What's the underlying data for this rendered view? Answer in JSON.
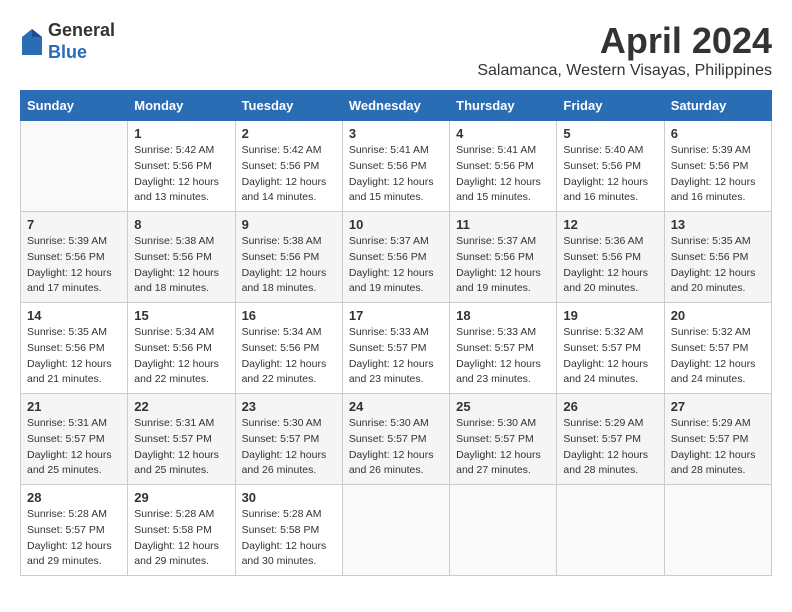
{
  "logo": {
    "general": "General",
    "blue": "Blue"
  },
  "title": "April 2024",
  "location": "Salamanca, Western Visayas, Philippines",
  "days_header": [
    "Sunday",
    "Monday",
    "Tuesday",
    "Wednesday",
    "Thursday",
    "Friday",
    "Saturday"
  ],
  "weeks": [
    [
      {
        "day": "",
        "info": ""
      },
      {
        "day": "1",
        "info": "Sunrise: 5:42 AM\nSunset: 5:56 PM\nDaylight: 12 hours\nand 13 minutes."
      },
      {
        "day": "2",
        "info": "Sunrise: 5:42 AM\nSunset: 5:56 PM\nDaylight: 12 hours\nand 14 minutes."
      },
      {
        "day": "3",
        "info": "Sunrise: 5:41 AM\nSunset: 5:56 PM\nDaylight: 12 hours\nand 15 minutes."
      },
      {
        "day": "4",
        "info": "Sunrise: 5:41 AM\nSunset: 5:56 PM\nDaylight: 12 hours\nand 15 minutes."
      },
      {
        "day": "5",
        "info": "Sunrise: 5:40 AM\nSunset: 5:56 PM\nDaylight: 12 hours\nand 16 minutes."
      },
      {
        "day": "6",
        "info": "Sunrise: 5:39 AM\nSunset: 5:56 PM\nDaylight: 12 hours\nand 16 minutes."
      }
    ],
    [
      {
        "day": "7",
        "info": "Sunrise: 5:39 AM\nSunset: 5:56 PM\nDaylight: 12 hours\nand 17 minutes."
      },
      {
        "day": "8",
        "info": "Sunrise: 5:38 AM\nSunset: 5:56 PM\nDaylight: 12 hours\nand 18 minutes."
      },
      {
        "day": "9",
        "info": "Sunrise: 5:38 AM\nSunset: 5:56 PM\nDaylight: 12 hours\nand 18 minutes."
      },
      {
        "day": "10",
        "info": "Sunrise: 5:37 AM\nSunset: 5:56 PM\nDaylight: 12 hours\nand 19 minutes."
      },
      {
        "day": "11",
        "info": "Sunrise: 5:37 AM\nSunset: 5:56 PM\nDaylight: 12 hours\nand 19 minutes."
      },
      {
        "day": "12",
        "info": "Sunrise: 5:36 AM\nSunset: 5:56 PM\nDaylight: 12 hours\nand 20 minutes."
      },
      {
        "day": "13",
        "info": "Sunrise: 5:35 AM\nSunset: 5:56 PM\nDaylight: 12 hours\nand 20 minutes."
      }
    ],
    [
      {
        "day": "14",
        "info": "Sunrise: 5:35 AM\nSunset: 5:56 PM\nDaylight: 12 hours\nand 21 minutes."
      },
      {
        "day": "15",
        "info": "Sunrise: 5:34 AM\nSunset: 5:56 PM\nDaylight: 12 hours\nand 22 minutes."
      },
      {
        "day": "16",
        "info": "Sunrise: 5:34 AM\nSunset: 5:56 PM\nDaylight: 12 hours\nand 22 minutes."
      },
      {
        "day": "17",
        "info": "Sunrise: 5:33 AM\nSunset: 5:57 PM\nDaylight: 12 hours\nand 23 minutes."
      },
      {
        "day": "18",
        "info": "Sunrise: 5:33 AM\nSunset: 5:57 PM\nDaylight: 12 hours\nand 23 minutes."
      },
      {
        "day": "19",
        "info": "Sunrise: 5:32 AM\nSunset: 5:57 PM\nDaylight: 12 hours\nand 24 minutes."
      },
      {
        "day": "20",
        "info": "Sunrise: 5:32 AM\nSunset: 5:57 PM\nDaylight: 12 hours\nand 24 minutes."
      }
    ],
    [
      {
        "day": "21",
        "info": "Sunrise: 5:31 AM\nSunset: 5:57 PM\nDaylight: 12 hours\nand 25 minutes."
      },
      {
        "day": "22",
        "info": "Sunrise: 5:31 AM\nSunset: 5:57 PM\nDaylight: 12 hours\nand 25 minutes."
      },
      {
        "day": "23",
        "info": "Sunrise: 5:30 AM\nSunset: 5:57 PM\nDaylight: 12 hours\nand 26 minutes."
      },
      {
        "day": "24",
        "info": "Sunrise: 5:30 AM\nSunset: 5:57 PM\nDaylight: 12 hours\nand 26 minutes."
      },
      {
        "day": "25",
        "info": "Sunrise: 5:30 AM\nSunset: 5:57 PM\nDaylight: 12 hours\nand 27 minutes."
      },
      {
        "day": "26",
        "info": "Sunrise: 5:29 AM\nSunset: 5:57 PM\nDaylight: 12 hours\nand 28 minutes."
      },
      {
        "day": "27",
        "info": "Sunrise: 5:29 AM\nSunset: 5:57 PM\nDaylight: 12 hours\nand 28 minutes."
      }
    ],
    [
      {
        "day": "28",
        "info": "Sunrise: 5:28 AM\nSunset: 5:57 PM\nDaylight: 12 hours\nand 29 minutes."
      },
      {
        "day": "29",
        "info": "Sunrise: 5:28 AM\nSunset: 5:58 PM\nDaylight: 12 hours\nand 29 minutes."
      },
      {
        "day": "30",
        "info": "Sunrise: 5:28 AM\nSunset: 5:58 PM\nDaylight: 12 hours\nand 30 minutes."
      },
      {
        "day": "",
        "info": ""
      },
      {
        "day": "",
        "info": ""
      },
      {
        "day": "",
        "info": ""
      },
      {
        "day": "",
        "info": ""
      }
    ]
  ]
}
